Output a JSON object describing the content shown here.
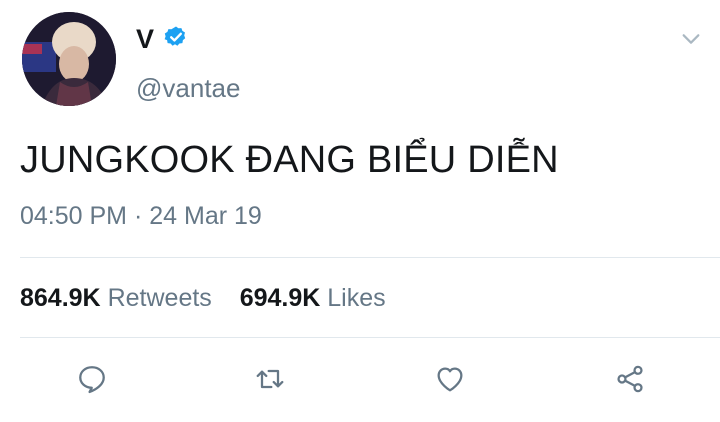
{
  "tweet": {
    "display_name": "V",
    "handle": "@vantae",
    "verified": true,
    "text": "JUNGKOOK ĐANG BIỂU DIỄN",
    "timestamp": "04:50 PM",
    "separator": "·",
    "date": "24 Mar 19"
  },
  "stats": {
    "retweets_count": "864.9K",
    "retweets_label": "Retweets",
    "likes_count": "694.9K",
    "likes_label": "Likes"
  },
  "icons": {
    "verified": "verified-badge-icon",
    "menu": "chevron-down-icon",
    "reply": "reply-icon",
    "retweet": "retweet-icon",
    "like": "heart-icon",
    "share": "share-icon"
  },
  "colors": {
    "verified_blue": "#1da1f2",
    "text_primary": "#14171a",
    "text_secondary": "#657786",
    "divider": "#e1e8ed",
    "icon_gray": "#657786"
  }
}
